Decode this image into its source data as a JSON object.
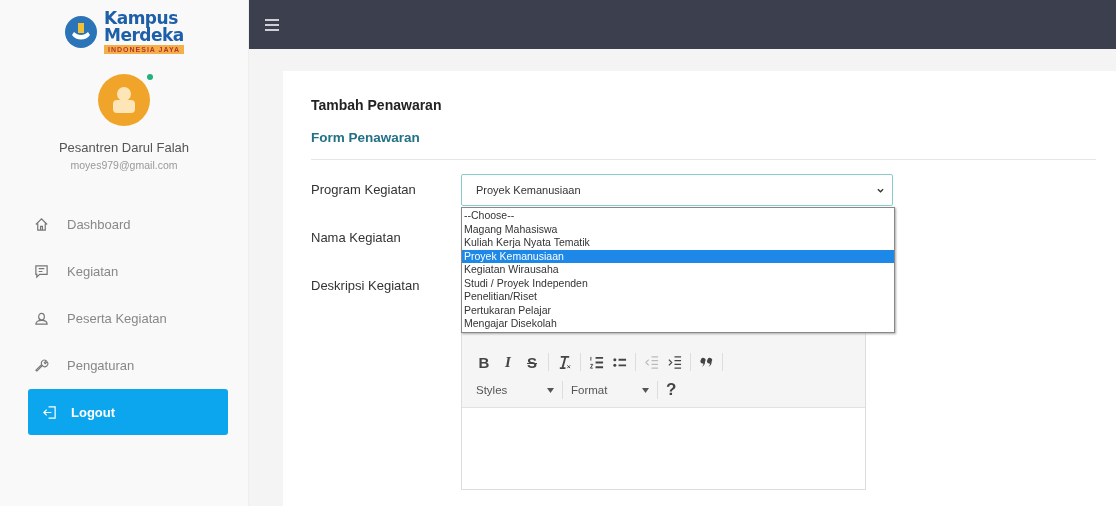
{
  "sidebar": {
    "logo": {
      "line_1": "Kampus",
      "line_2": "Merdeka",
      "tagline": "INDONESIA JAYA"
    },
    "user": {
      "name": "Pesantren Darul Falah",
      "email": "moyes979@gmail.com",
      "online": true
    },
    "nav": [
      {
        "label": "Dashboard"
      },
      {
        "label": "Kegiatan"
      },
      {
        "label": "Peserta Kegiatan"
      },
      {
        "label": "Pengaturan"
      }
    ],
    "logout": "Logout"
  },
  "form": {
    "title": "Tambah Penawaran",
    "subtitle": "Form Penawaran",
    "fields": [
      {
        "label": "Program Kegiatan",
        "kind": "select",
        "value": "Proyek Kemanusiaan",
        "expanded": true,
        "options": [
          {
            "label": "--Choose--",
            "selected": false
          },
          {
            "label": "Magang Mahasiswa",
            "selected": false
          },
          {
            "label": "Kuliah Kerja Nyata Tematik",
            "selected": false
          },
          {
            "label": "Proyek Kemanusiaan",
            "selected": true
          },
          {
            "label": "Kegiatan Wirausaha",
            "selected": false
          },
          {
            "label": "Studi / Proyek Independen",
            "selected": false
          },
          {
            "label": "Penelitian/Riset",
            "selected": false
          },
          {
            "label": "Pertukaran Pelajar",
            "selected": false
          },
          {
            "label": "Mengajar Disekolah",
            "selected": false
          }
        ]
      },
      {
        "label": "Nama Kegiatan",
        "kind": "text"
      },
      {
        "label": "Deskripsi Kegiatan",
        "kind": "editor",
        "toolbar": [
          {
            "kind": "bold",
            "text": "B"
          },
          {
            "kind": "italic",
            "text": "I"
          },
          {
            "kind": "strike",
            "text": "S"
          },
          {
            "kind": "sep"
          },
          {
            "kind": "clear-format"
          },
          {
            "kind": "sep"
          },
          {
            "kind": "numbered-list"
          },
          {
            "kind": "bulleted-list"
          },
          {
            "kind": "sep"
          },
          {
            "kind": "outdent",
            "disabled": true
          },
          {
            "kind": "indent",
            "disabled": false
          },
          {
            "kind": "sep"
          },
          {
            "kind": "quote"
          },
          {
            "kind": "sep"
          }
        ],
        "dropdowns": [
          "Styles",
          "Format"
        ],
        "help": "?"
      }
    ]
  }
}
